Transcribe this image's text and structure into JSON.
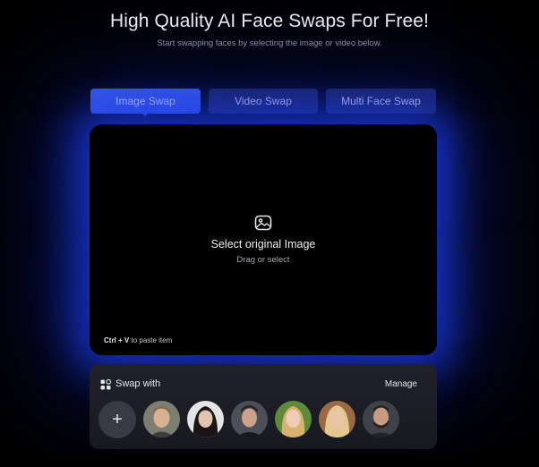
{
  "header": {
    "title": "High Quality AI Face Swaps For Free!",
    "subtitle": "Start swapping faces by selecting the image or video below."
  },
  "tabs": [
    {
      "label": "Image Swap",
      "active": true
    },
    {
      "label": "Video Swap",
      "active": false
    },
    {
      "label": "Multi Face Swap",
      "active": false
    }
  ],
  "dropzone": {
    "icon": "image-icon",
    "title": "Select original Image",
    "subtitle": "Drag or select",
    "shortcut_key": "Ctrl + V",
    "shortcut_text": "to paste item"
  },
  "swap_with": {
    "label": "Swap with",
    "icon": "faces-icon",
    "manage_label": "Manage",
    "add_icon": "plus-icon",
    "add_symbol": "+",
    "faces": [
      {
        "name": "face-1"
      },
      {
        "name": "face-2"
      },
      {
        "name": "face-3"
      },
      {
        "name": "face-4"
      },
      {
        "name": "face-5"
      },
      {
        "name": "face-6"
      }
    ]
  },
  "colors": {
    "accent": "#3f61ee",
    "tab_inactive": "#1c2450",
    "glow": "#1c3ceb",
    "background": "#000000",
    "panel": "#1d1e27"
  }
}
